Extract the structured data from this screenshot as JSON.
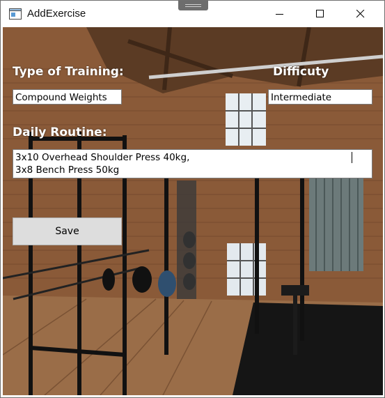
{
  "window": {
    "title": "AddExercise"
  },
  "form": {
    "training_label": "Type of Training:",
    "training_value": "Compound Weights",
    "difficulty_label": "Difficuty",
    "difficulty_value": "Intermediate",
    "routine_label": "Daily Routine:",
    "routine_lines": [
      "3x10 Overhead Shoulder Press 40kg,",
      "3x8 Bench Press 50kg"
    ],
    "save_label": "Save"
  },
  "icons": [
    "app-icon",
    "minimize-icon",
    "maximize-icon",
    "close-icon"
  ],
  "colors": {
    "label_text": "#ffffff",
    "button_bg": "#dddddd",
    "field_bg": "#ffffff"
  }
}
